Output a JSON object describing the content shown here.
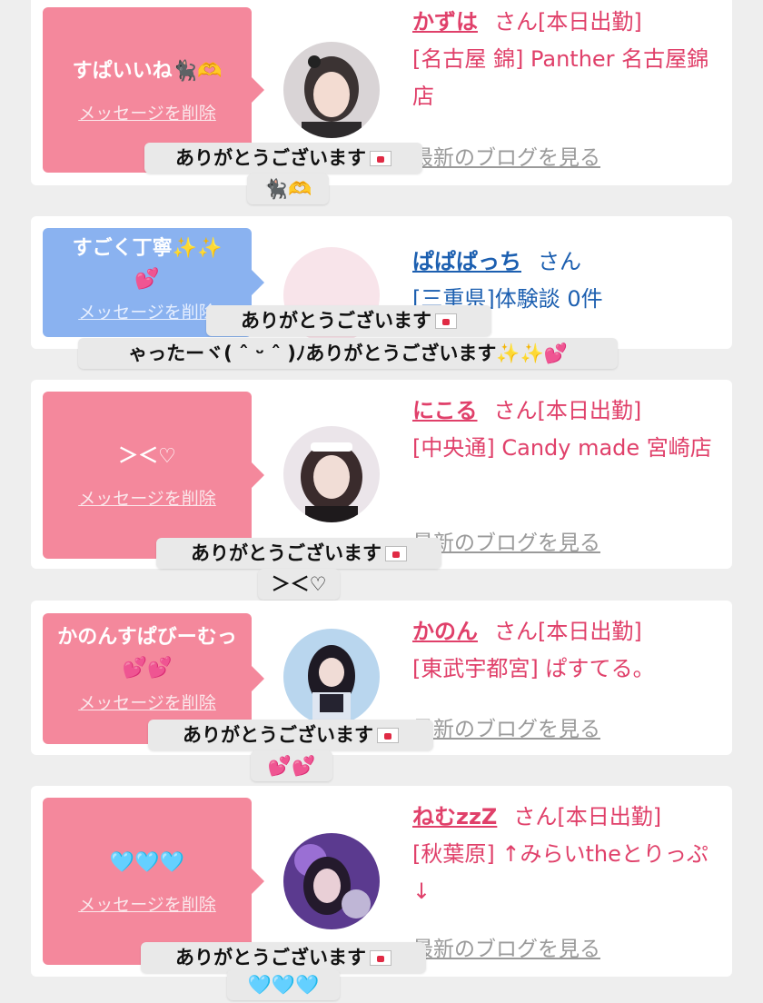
{
  "cards": [
    {
      "message": "すぱいいね🐈‍⬛🫶",
      "delete_label": "メッセージを削除",
      "name": "かずは",
      "honorific": "さん",
      "status": "[本日出勤]",
      "shop": "[名古屋 錦] Panther 名古屋錦店",
      "blog_link": "最新のブログを見る",
      "reply": "ありがとうございます",
      "reply_emoji": "🐈‍⬛🫶"
    },
    {
      "message": "すごく丁寧✨✨💕",
      "delete_label": "メッセージを削除",
      "name": "ぱぱぱっち",
      "honorific": "さん",
      "detail": "[三重県]体験談 0件",
      "reply": "ありがとうございます",
      "reply_line2": "ゃったーヾ( ˆ ᵕ ˆ )ﾉありがとうございます✨✨💕"
    },
    {
      "message": "＞＜♡",
      "delete_label": "メッセージを削除",
      "name": "にこる",
      "honorific": "さん",
      "status": "[本日出勤]",
      "shop": "[中央通] Candy made 宮崎店",
      "blog_link": "最新のブログを見る",
      "reply": "ありがとうございます",
      "reply_emoji": "＞＜♡"
    },
    {
      "message": "かのんすぱびーむっ💕💕",
      "delete_label": "メッセージを削除",
      "name": "かのん",
      "honorific": "さん",
      "status": "[本日出勤]",
      "shop": "[東武宇都宮] ぱすてる。",
      "blog_link": "最新のブログを見る",
      "reply": "ありがとうございます",
      "reply_emoji": "💕💕"
    },
    {
      "message": "🩵🩵🩵",
      "delete_label": "メッセージを削除",
      "name": "ねむzzZ",
      "honorific": "さん",
      "status": "[本日出勤]",
      "shop": "[秋葉原] ↑みらいtheとりっぷ↓",
      "blog_link": "最新のブログを見る",
      "reply": "ありがとうございます",
      "reply_emoji": "🩵🩵🩵"
    }
  ],
  "colors": {
    "pink_bubble": "#f4889c",
    "blue_bubble": "#8ab2f0",
    "name_pink": "#e0406a",
    "name_blue": "#1c5fb0",
    "background": "#eeeeee"
  }
}
